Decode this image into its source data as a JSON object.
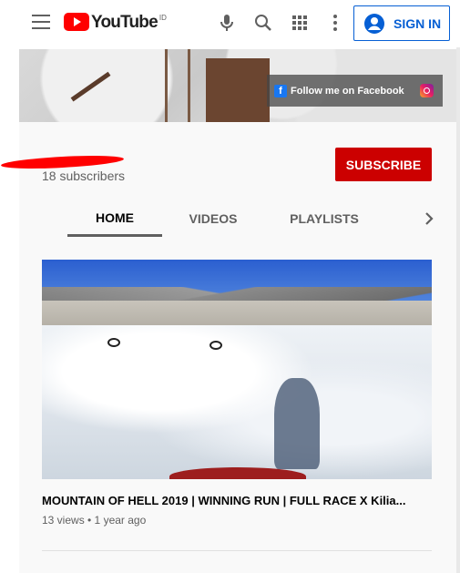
{
  "header": {
    "logo_text": "YouTube",
    "country_code": "ID",
    "signin_label": "SIGN IN"
  },
  "banner": {
    "facebook_text": "Follow me on Facebook"
  },
  "channel": {
    "name": "",
    "subscribers": "18 subscribers",
    "subscribe_label": "SUBSCRIBE"
  },
  "tabs": [
    {
      "label": "HOME"
    },
    {
      "label": "VIDEOS"
    },
    {
      "label": "PLAYLISTS"
    }
  ],
  "video": {
    "title": "MOUNTAIN OF HELL 2019 | WINNING RUN | FULL RACE X Kilia...",
    "meta": "13 views • 1 year ago"
  },
  "colors": {
    "accent": "#065fd4",
    "subscribe": "#cc0000",
    "brand": "#ff0000"
  }
}
